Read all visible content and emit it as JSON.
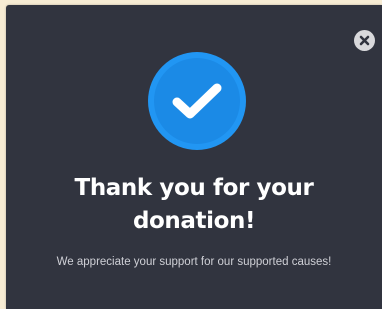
{
  "modal": {
    "close_icon": "close-icon",
    "status_icon": "checkmark-icon",
    "title_line1": "Thank you for your",
    "title_line2": "donation!",
    "message": "We appreciate your support for our supported causes!"
  },
  "colors": {
    "background": "#f7ecd4",
    "modal_bg": "#31343f",
    "accent": "#2196f3",
    "close_bg": "#d9d9dc",
    "text": "#ffffff",
    "muted_text": "#cfd0d6"
  }
}
